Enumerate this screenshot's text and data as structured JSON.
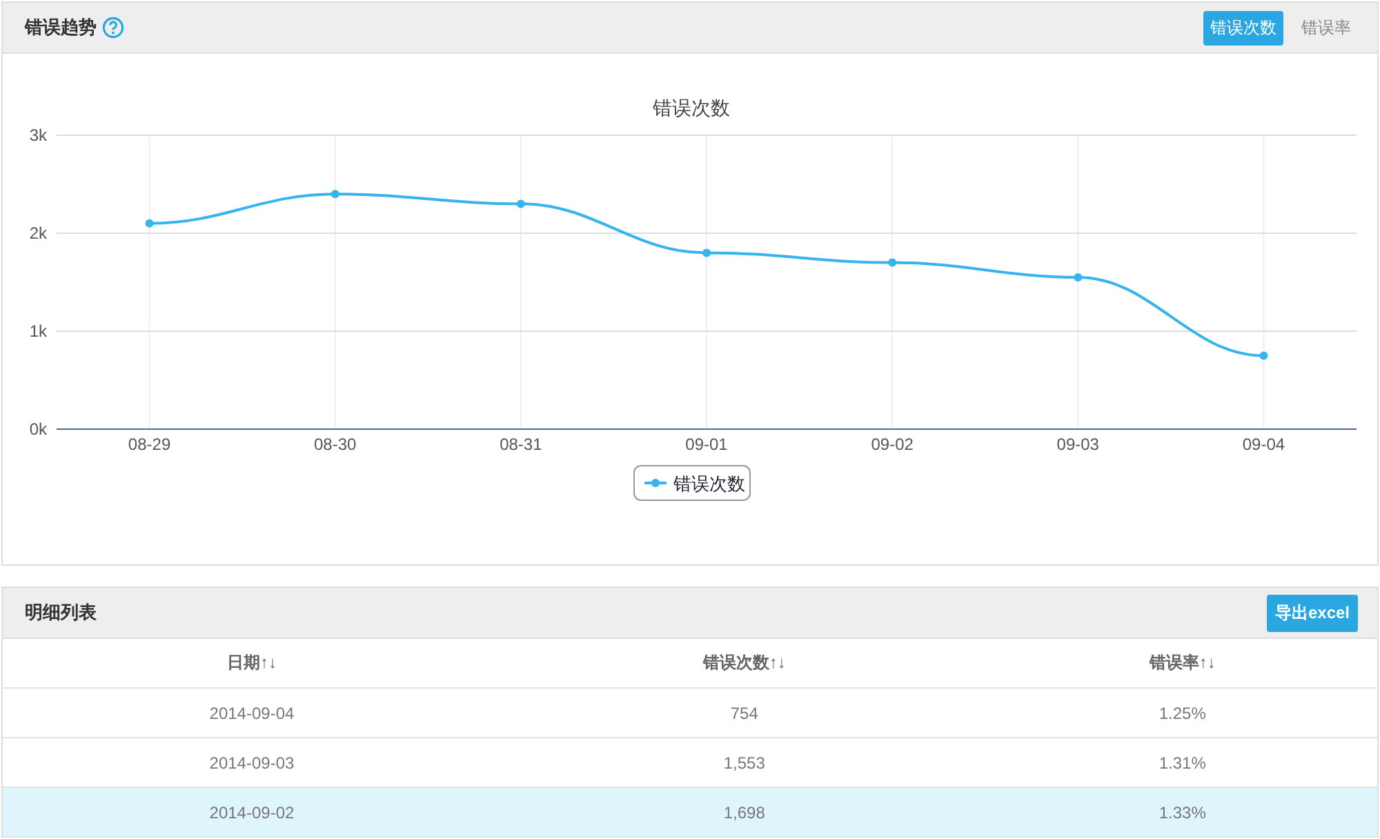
{
  "trend_panel": {
    "title": "错误趋势",
    "tabs": [
      {
        "label": "错误次数",
        "selected": true
      },
      {
        "label": "错误率",
        "selected": false
      }
    ],
    "chart_data": {
      "type": "line",
      "title": "错误次数",
      "categories": [
        "08-29",
        "08-30",
        "08-31",
        "09-01",
        "09-02",
        "09-03",
        "09-04"
      ],
      "grid": true,
      "series": [
        {
          "name": "错误次数",
          "color": "#35b4ee",
          "marker": true,
          "values": [
            2100,
            2400,
            2300,
            1800,
            1700,
            1550,
            750
          ]
        }
      ],
      "ylim": [
        0,
        3000
      ],
      "yticks": [
        {
          "value": 0,
          "label": "0k"
        },
        {
          "value": 1000,
          "label": "1k"
        },
        {
          "value": 2000,
          "label": "2k"
        },
        {
          "value": 3000,
          "label": "3k"
        }
      ]
    }
  },
  "detail_panel": {
    "title": "明细列表",
    "export_button": "导出excel",
    "table": {
      "columns": [
        "日期↑↓",
        "错误次数↑↓",
        "错误率↑↓"
      ],
      "rows": [
        {
          "cells": [
            "2014-09-04",
            "754",
            "1.25%"
          ],
          "selected": false
        },
        {
          "cells": [
            "2014-09-03",
            "1,553",
            "1.31%"
          ],
          "selected": false
        },
        {
          "cells": [
            "2014-09-02",
            "1,698",
            "1.33%"
          ],
          "selected": true
        }
      ]
    }
  }
}
